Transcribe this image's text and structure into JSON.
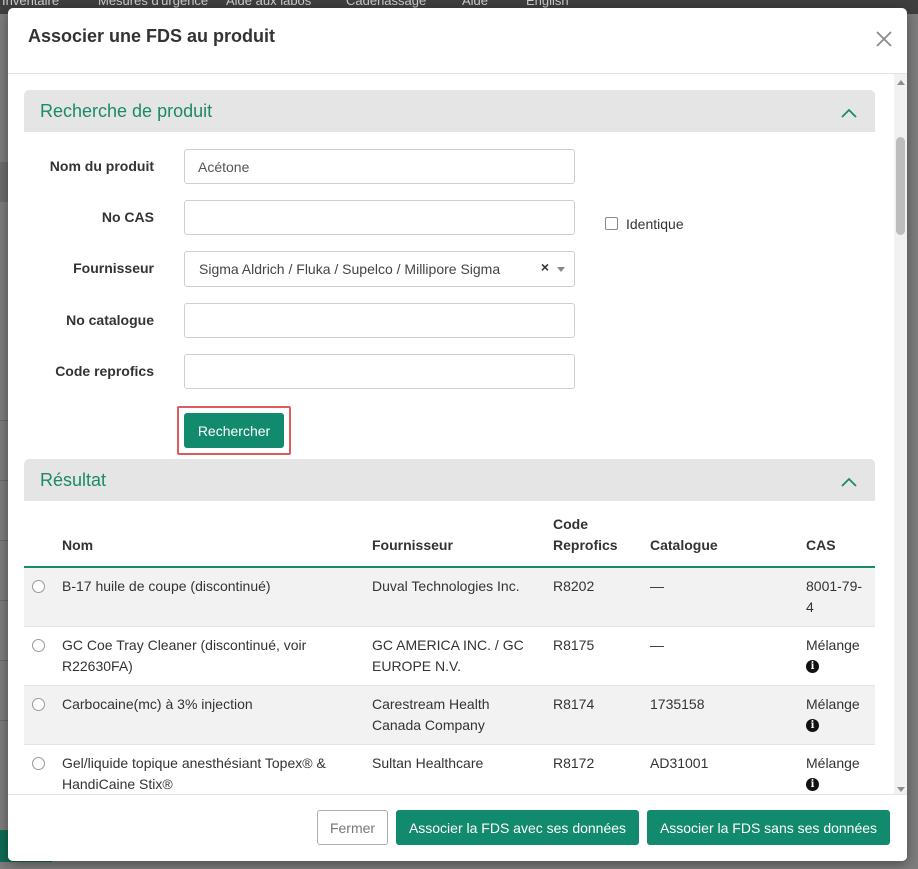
{
  "background_nav": [
    "Inventaire",
    "Mesures d'urgence",
    "Aide aux labos",
    "Cadenassage",
    "Aide",
    "English"
  ],
  "modal": {
    "title": "Associer une FDS au produit"
  },
  "search_panel": {
    "title": "Recherche de produit",
    "fields": {
      "product_name_label": "Nom du produit",
      "product_name_value": "Acétone",
      "cas_label": "No CAS",
      "cas_value": "",
      "identical_label": "Identique",
      "identical_checked": false,
      "supplier_label": "Fournisseur",
      "supplier_value": "Sigma Aldrich / Fluka / Supelco / Millipore Sigma",
      "supplier_clear": "×",
      "catalog_label": "No catalogue",
      "catalog_value": "",
      "reprofics_label": "Code reprofics",
      "reprofics_value": ""
    },
    "search_button": "Rechercher"
  },
  "results_panel": {
    "title": "Résultat",
    "columns": {
      "name": "Nom",
      "supplier": "Fournisseur",
      "code": "Code Reprofics",
      "catalog": "Catalogue",
      "cas": "CAS"
    },
    "rows": [
      {
        "name": "B-17 huile de coupe (discontinué)",
        "supplier": "Duval Technologies Inc.",
        "code": "R8202",
        "catalog": "—",
        "cas": "8001-79-4",
        "info": false
      },
      {
        "name": "GC Coe Tray Cleaner (discontinué, voir R22630FA)",
        "supplier": "GC AMERICA INC. / GC EUROPE N.V.",
        "code": "R8175",
        "catalog": "—",
        "cas": "Mélange",
        "info": true
      },
      {
        "name": "Carbocaine(mc) à 3% injection",
        "supplier": "Carestream Health Canada Company",
        "code": "R8174",
        "catalog": "1735158",
        "cas": "Mélange",
        "info": true
      },
      {
        "name": "Gel/liquide topique anesthésiant Topex® & HandiCaine Stix®",
        "supplier": "Sultan Healthcare",
        "code": "R8172",
        "catalog": "AD31001",
        "cas": "Mélange",
        "info": true
      }
    ],
    "info_glyph": "i"
  },
  "footer": {
    "close_button": "Fermer",
    "associate_with_data_button": "Associer la FDS avec ses données",
    "associate_without_data_button": "Associer la FDS sans ses données"
  },
  "colors": {
    "accent": "#1a8a6a",
    "button_green": "#128a6e",
    "highlight_red": "#e0595c"
  }
}
